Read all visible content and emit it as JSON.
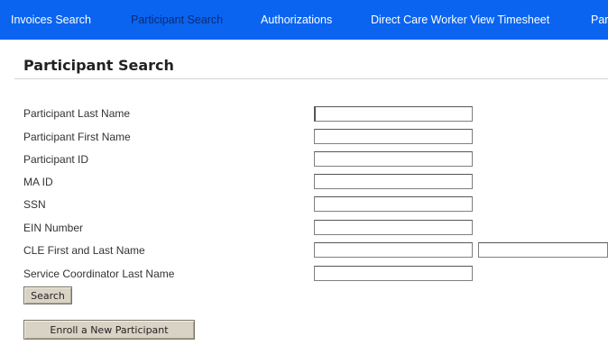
{
  "nav": {
    "items": [
      {
        "label": "Invoices Search",
        "active": false
      },
      {
        "label": "Participant Search",
        "active": true
      },
      {
        "label": "Authorizations",
        "active": false
      },
      {
        "label": "Direct Care Worker View Timesheet",
        "active": false
      },
      {
        "label": "Par",
        "active": false
      }
    ]
  },
  "page": {
    "title": "Participant Search"
  },
  "form": {
    "fields": [
      {
        "label": "Participant Last Name",
        "value": ""
      },
      {
        "label": "Participant First Name",
        "value": ""
      },
      {
        "label": "Participant ID",
        "value": ""
      },
      {
        "label": "MA ID",
        "value": ""
      },
      {
        "label": "SSN",
        "value": ""
      },
      {
        "label": "EIN Number",
        "value": ""
      },
      {
        "label": "CLE First and Last Name",
        "first_value": "",
        "last_value": ""
      },
      {
        "label": "Service Coordinator Last Name",
        "value": ""
      }
    ],
    "search_button": "Search",
    "enroll_button": "Enroll a New Participant"
  },
  "colors": {
    "nav_background": "#0a64f0",
    "nav_text": "#ffffff",
    "nav_active_text": "#0f2a70",
    "button_background": "#d8d3c5"
  }
}
